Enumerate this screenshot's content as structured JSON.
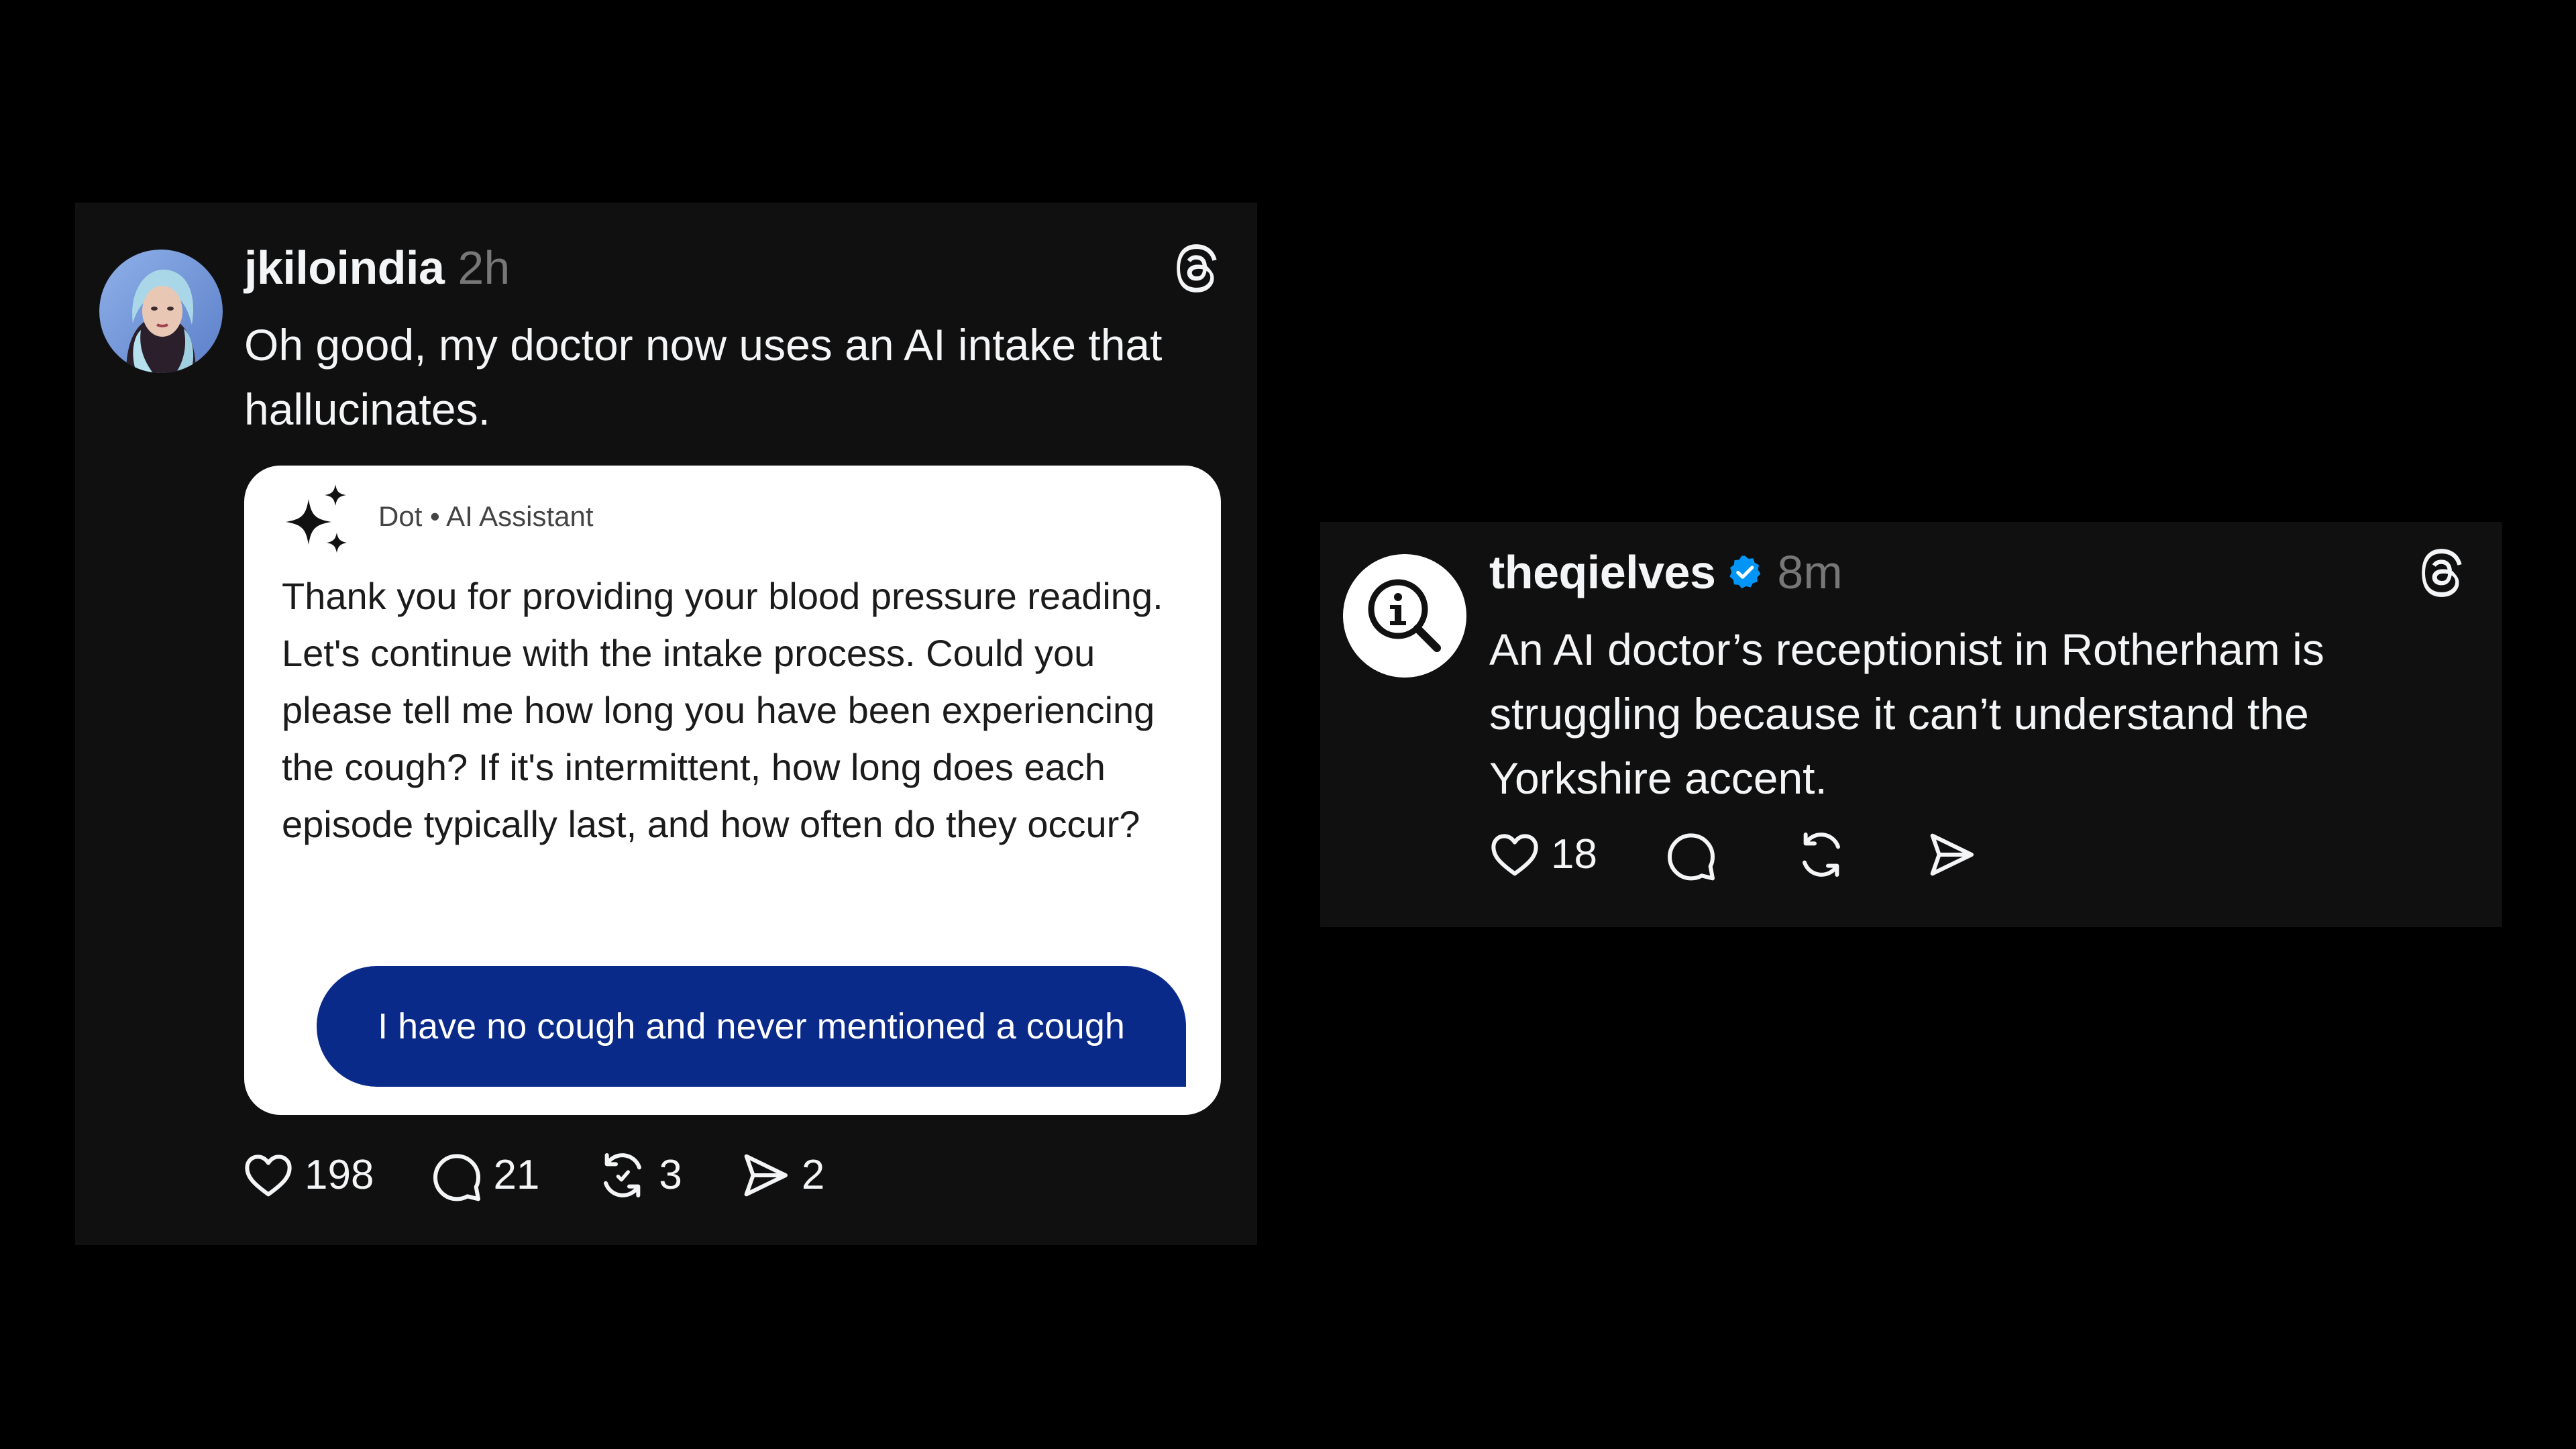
{
  "colors": {
    "background": "#000000",
    "card": "#101010",
    "text": "#f3f5f7",
    "muted": "#777777",
    "verified": "#0095f6",
    "user_bubble": "#0a2a8a"
  },
  "posts": [
    {
      "username": "jkiloindia",
      "time": "2h",
      "text": "Oh good, my doctor now uses an AI intake that hallucinates.",
      "verified": false,
      "logo_icon": "threads-logo-icon",
      "embed": {
        "assistant_icon": "sparkle-icon",
        "assistant_name": "Dot • AI Assistant",
        "ai_message": "Thank you for providing your blood pressure reading. Let's continue with the intake process. Could you please tell me how long you have been experiencing the cough? If it's intermittent, how long does each episode typically last, and how often do they occur?",
        "user_message": "I have no cough and never mentioned a cough"
      },
      "actions": {
        "likes": "198",
        "replies": "21",
        "reposts": "3",
        "shares": "2"
      }
    },
    {
      "username": "theqielves",
      "time": "8m",
      "text": "An AI doctor’s receptionist in Rotherham is struggling because it can’t understand the Yorkshire accent.",
      "verified": true,
      "logo_icon": "threads-logo-icon",
      "actions": {
        "likes": "18"
      }
    }
  ]
}
